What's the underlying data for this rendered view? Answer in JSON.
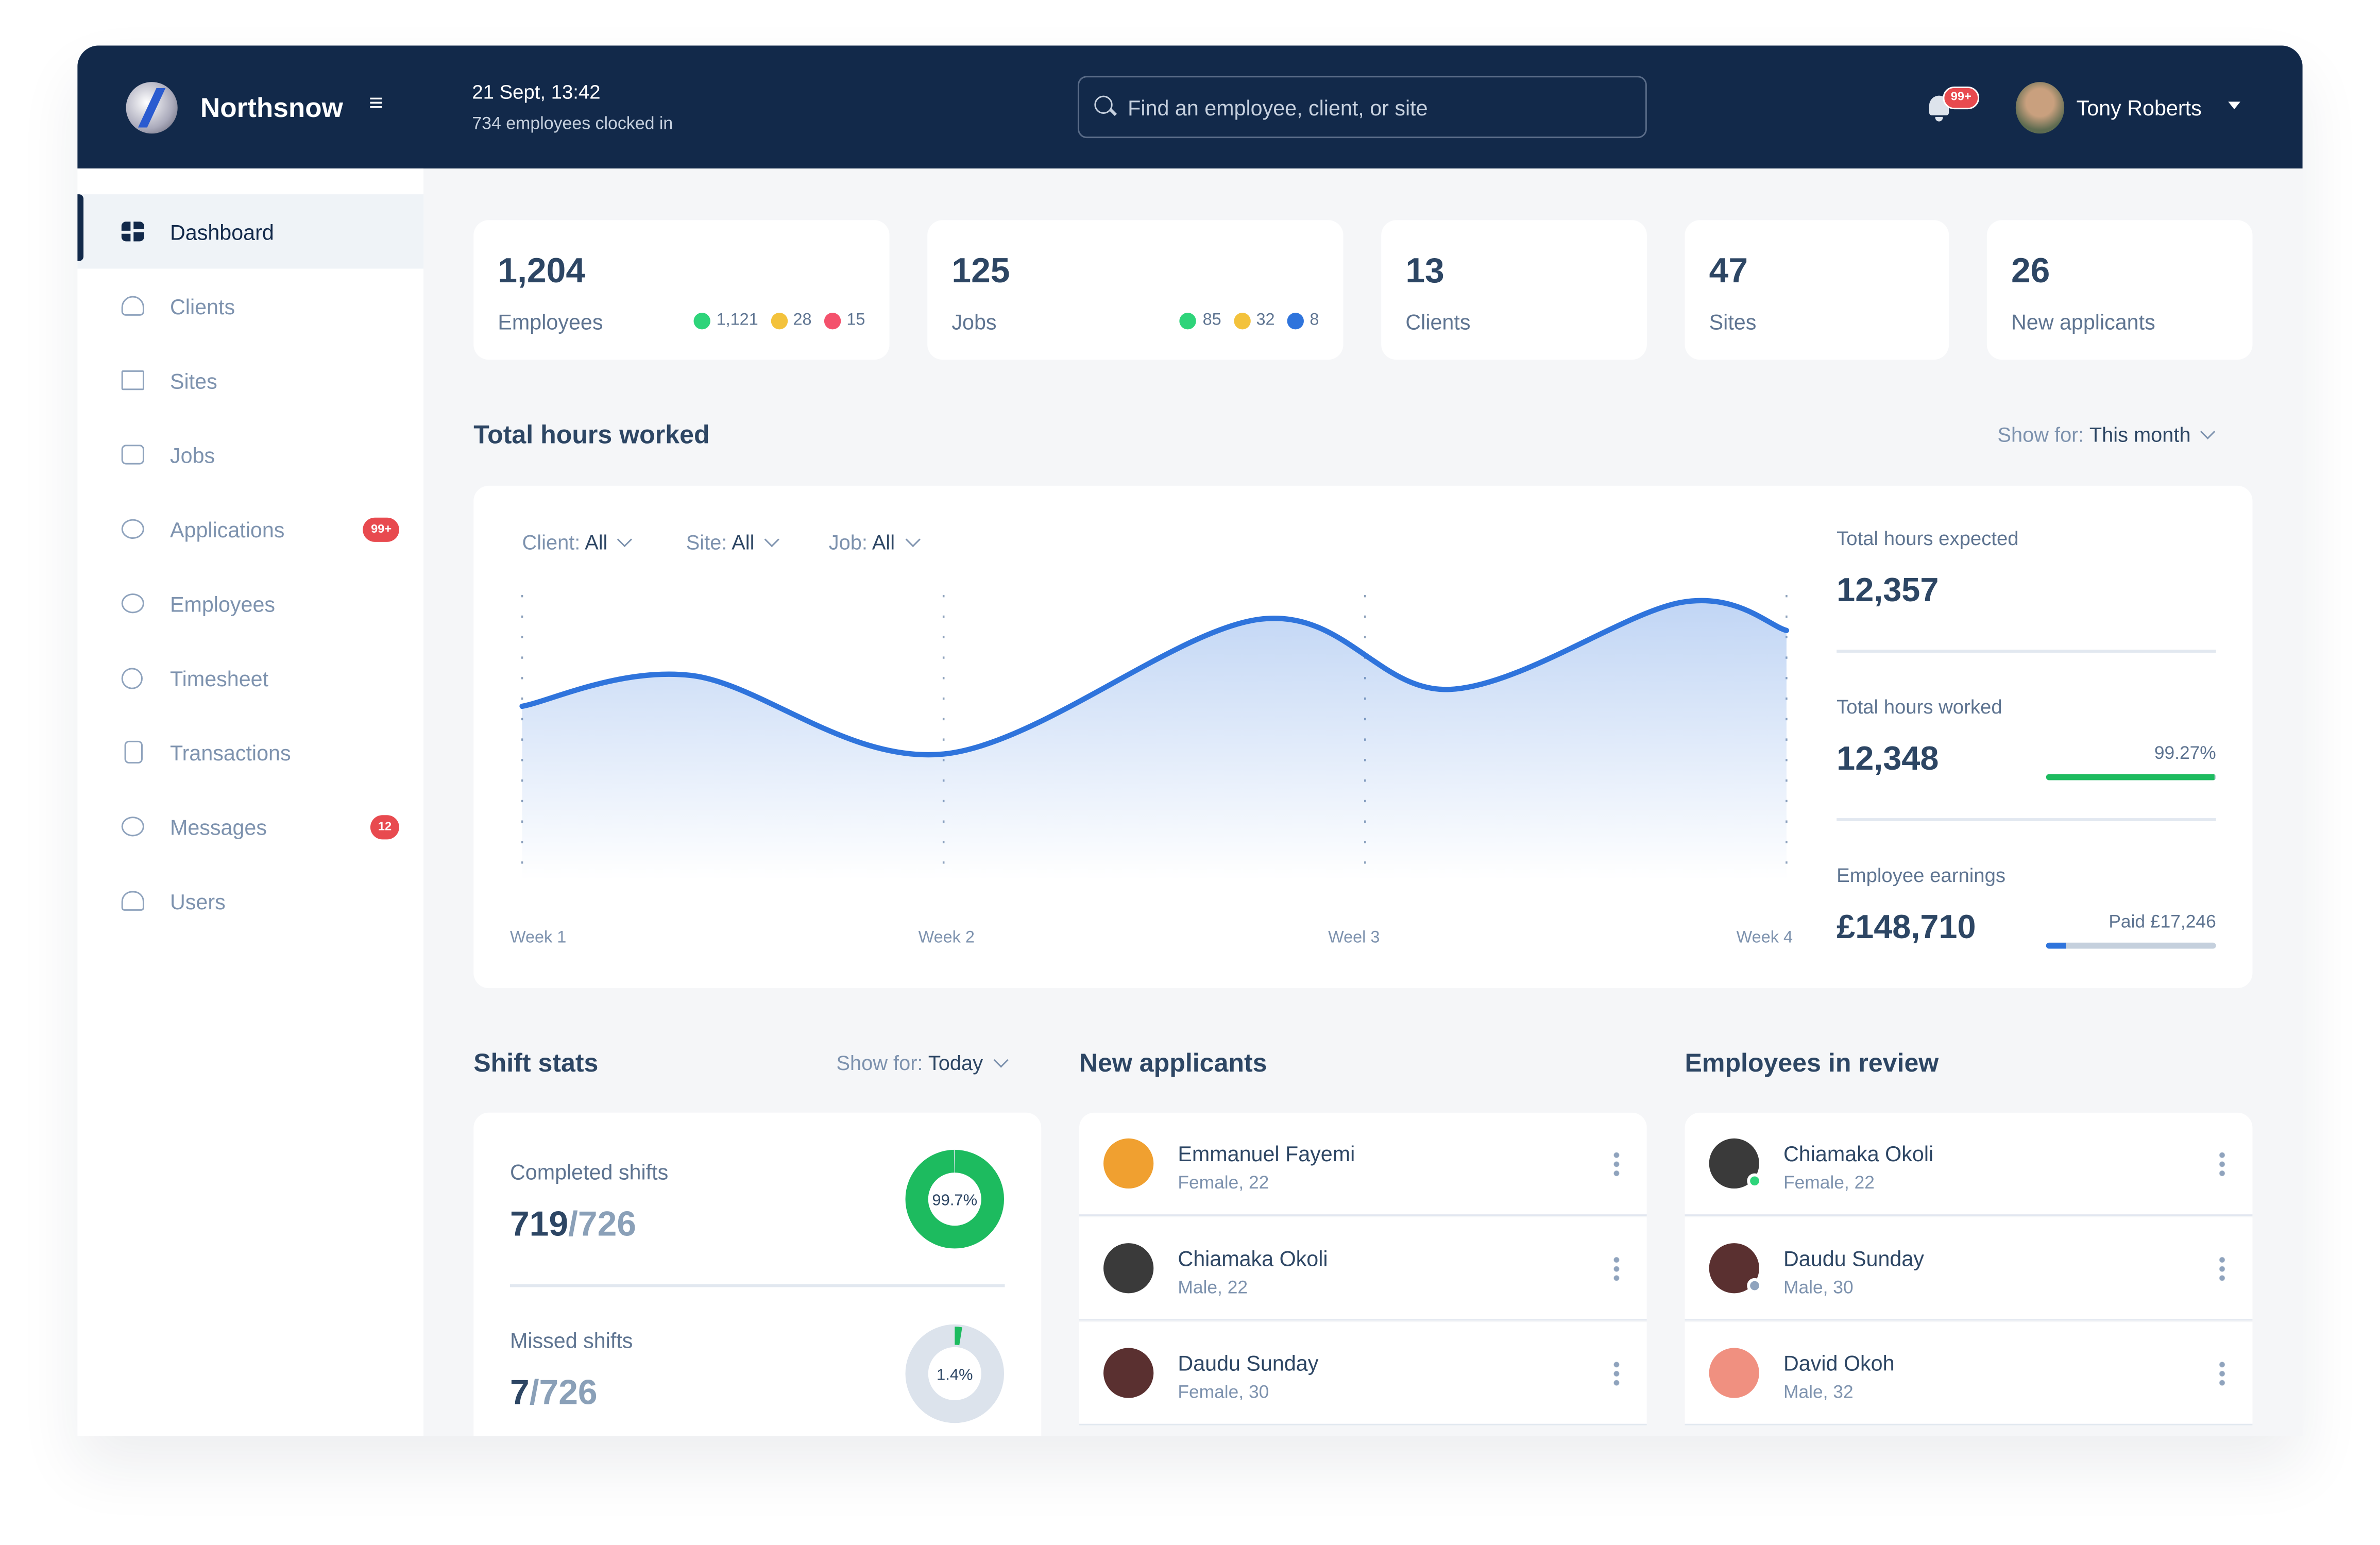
{
  "header": {
    "brand": "Northsnow",
    "date": "21 Sept, 13:42",
    "clocked_in": "734 employees clocked in",
    "search_placeholder": "Find an employee, client, or site",
    "notifications": "99+",
    "user_name": "Tony Roberts"
  },
  "sidebar": {
    "items": [
      {
        "label": "Dashboard",
        "icon": "dashboard-icon",
        "active": true
      },
      {
        "label": "Clients",
        "icon": "users-group-icon"
      },
      {
        "label": "Sites",
        "icon": "building-icon"
      },
      {
        "label": "Jobs",
        "icon": "briefcase-icon"
      },
      {
        "label": "Applications",
        "icon": "faces-icon",
        "badge": "99+"
      },
      {
        "label": "Employees",
        "icon": "faces-icon"
      },
      {
        "label": "Timesheet",
        "icon": "timer-icon"
      },
      {
        "label": "Transactions",
        "icon": "document-icon"
      },
      {
        "label": "Messages",
        "icon": "chat-icon",
        "badge": "12"
      },
      {
        "label": "Users",
        "icon": "user-icon"
      }
    ]
  },
  "stats": [
    {
      "value": "1,204",
      "label": "Employees",
      "breakdown": [
        {
          "color": "#2ed47a",
          "value": "1,121"
        },
        {
          "color": "#f3c23c",
          "value": "28"
        },
        {
          "color": "#f4516c",
          "value": "15"
        }
      ]
    },
    {
      "value": "125",
      "label": "Jobs",
      "breakdown": [
        {
          "color": "#2ed47a",
          "value": "85"
        },
        {
          "color": "#f3c23c",
          "value": "32"
        },
        {
          "color": "#2f74dc",
          "value": "8"
        }
      ]
    },
    {
      "value": "13",
      "label": "Clients"
    },
    {
      "value": "47",
      "label": "Sites"
    },
    {
      "value": "26",
      "label": "New applicants"
    }
  ],
  "hours": {
    "title": "Total hours worked",
    "show_for_label": "Show for:",
    "show_for_value": "This month",
    "filters": [
      {
        "label": "Client:",
        "value": "All"
      },
      {
        "label": "Site:",
        "value": "All"
      },
      {
        "label": "Job:",
        "value": "All"
      }
    ],
    "expected_label": "Total hours expected",
    "expected_value": "12,357",
    "worked_label": "Total hours worked",
    "worked_value": "12,348",
    "worked_pct_text": "99.27%",
    "worked_pct": 99.27,
    "earnings_label": "Employee earnings",
    "earnings_value": "£148,710",
    "paid_text": "Paid £17,246",
    "paid_fraction": 0.116
  },
  "chart_data": {
    "type": "area",
    "categories": [
      "Week 1",
      "Week 2",
      "Weel 3",
      "Week 4"
    ],
    "x": [
      1,
      1.4,
      2,
      2.75,
      3.2,
      3.75,
      4
    ],
    "values": [
      62,
      73,
      45,
      93,
      68,
      99,
      89
    ],
    "ylim": [
      0,
      100
    ],
    "grid": "vertical dotted lines at each week",
    "color": "#2f74dc"
  },
  "shifts": {
    "title": "Shift stats",
    "show_for_label": "Show for:",
    "show_for_value": "Today",
    "completed_label": "Completed shifts",
    "completed": "719",
    "completed_total": "/726",
    "completed_pct_text": "99.7%",
    "completed_pct": 99.7,
    "missed_label": "Missed shifts",
    "missed": "7",
    "missed_total": "/726",
    "missed_pct_text": "1.4%",
    "missed_pct": 1.4
  },
  "applicants": {
    "title": "New applicants",
    "rows": [
      {
        "name": "Emmanuel Fayemi",
        "meta": "Female, 22",
        "avatar_color": "#f0a030"
      },
      {
        "name": "Chiamaka Okoli",
        "meta": "Male, 22",
        "avatar_color": "#3a3a3a"
      },
      {
        "name": "Daudu Sunday",
        "meta": "Female, 30",
        "avatar_color": "#5a3030"
      }
    ]
  },
  "review": {
    "title": "Employees in review",
    "rows": [
      {
        "name": "Chiamaka Okoli",
        "meta": "Female, 22",
        "avatar_color": "#3a3a3a",
        "status_color": "#2ed47a"
      },
      {
        "name": "Daudu Sunday",
        "meta": "Male, 30",
        "avatar_color": "#5a3030",
        "status_color": "#8fa3bd"
      },
      {
        "name": "David Okoh",
        "meta": "Male, 32",
        "avatar_color": "#f09080"
      }
    ]
  }
}
